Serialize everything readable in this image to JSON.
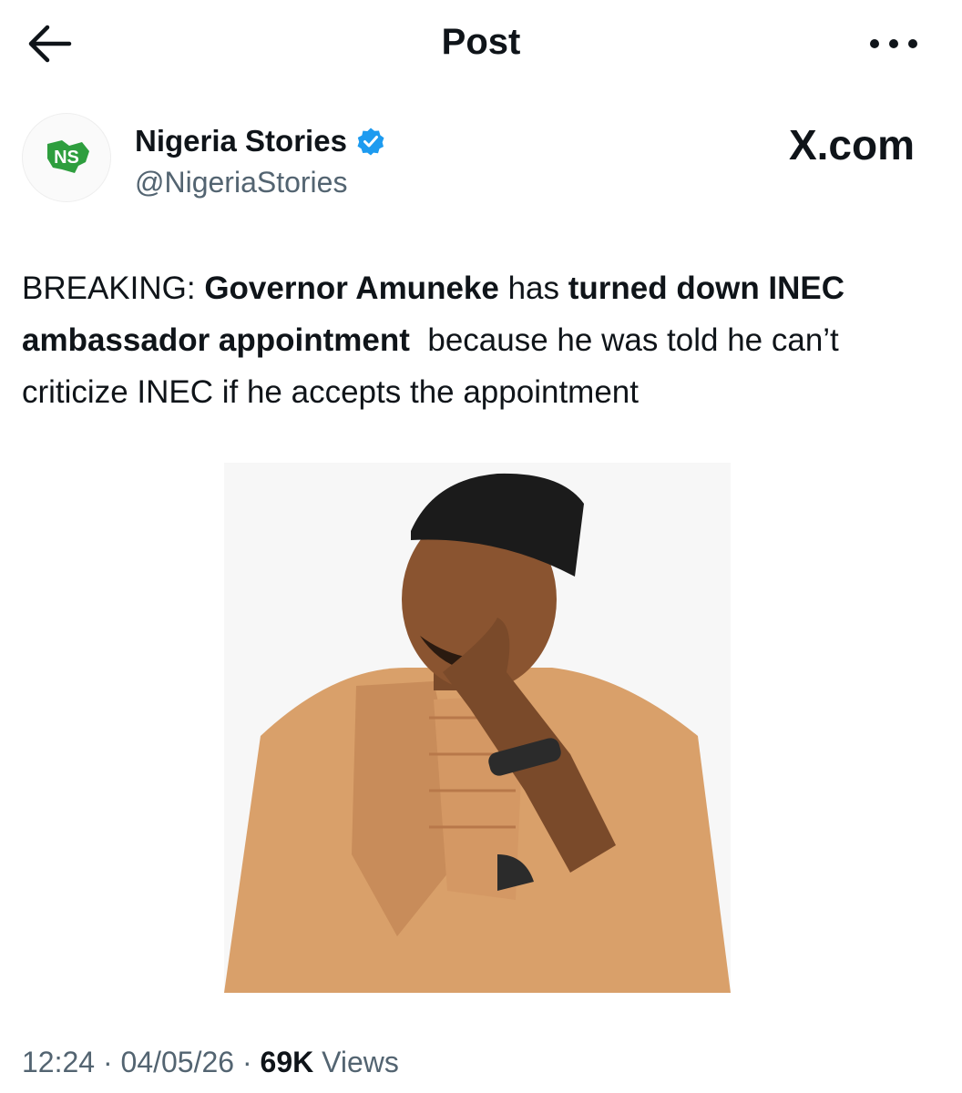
{
  "topbar": {
    "back_icon": "arrow-left-icon",
    "title": "Post",
    "more_icon": "more-horizontal-icon"
  },
  "author": {
    "avatar_text": "NS",
    "name": "Nigeria Stories",
    "verified_icon": "verified-badge-icon",
    "handle": "@NigeriaStories"
  },
  "watermark": "X.com",
  "tweet": {
    "segments": [
      {
        "text": "BREAKING: ",
        "bold": false
      },
      {
        "text": "Governor Amuneke",
        "bold": true
      },
      {
        "text": " has ",
        "bold": false
      },
      {
        "text": "turned down INEC ambassador appointment",
        "bold": true
      },
      {
        "text": "  because he was told he can’t criticize INEC if he accepts the appointment",
        "bold": false
      }
    ]
  },
  "media": {
    "image_alt": "Man in a black cap and tan agbada posing with hand on chin"
  },
  "meta": {
    "time": "12:24",
    "sep1": " · ",
    "date": "04/05/26",
    "sep2": " · ",
    "views_count": "69K",
    "views_label": " Views"
  },
  "colors": {
    "text": "#0f1419",
    "secondary": "#536471",
    "verified": "#1d9bf0",
    "brand_green": "#2e9e3e"
  }
}
